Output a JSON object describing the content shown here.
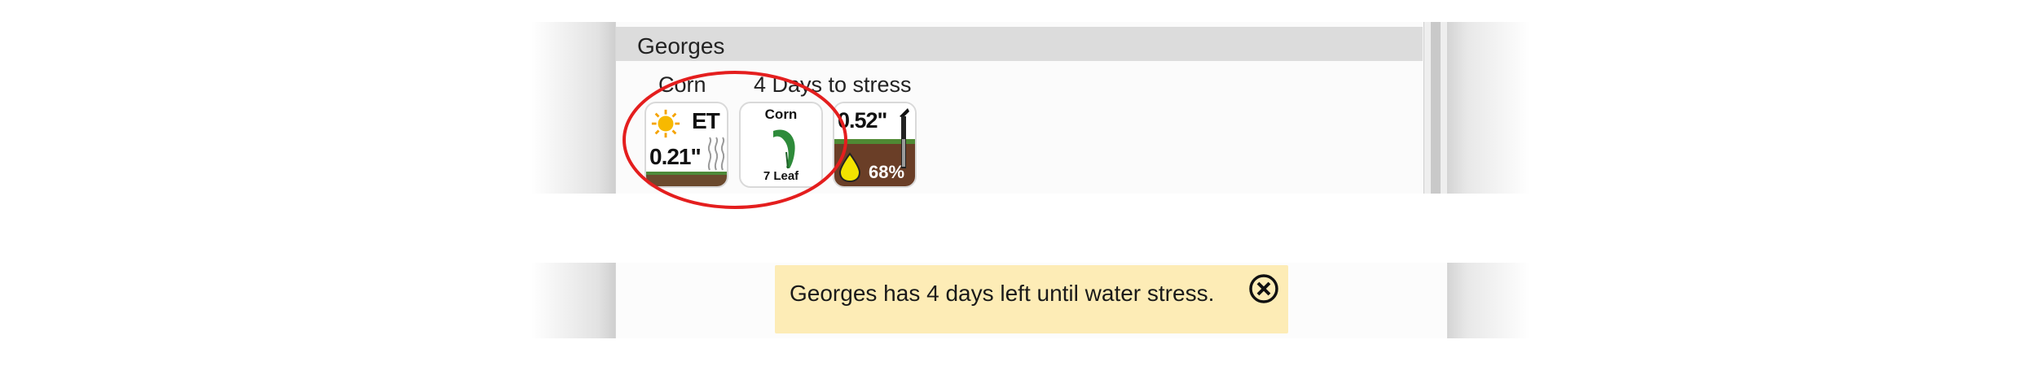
{
  "field": {
    "name": "Georges",
    "crop": "Corn",
    "stress_text": "4 Days to stress"
  },
  "tiles": {
    "et": {
      "label": "ET",
      "value": "0.21\"",
      "icon": "sun-icon"
    },
    "crop": {
      "name": "Corn",
      "stage": "7 Leaf",
      "icon": "leaf-icon"
    },
    "soil": {
      "value": "0.52\"",
      "moisture": "68%",
      "icons": [
        "probe-icon",
        "water-drop-icon"
      ]
    }
  },
  "alert": {
    "message": "Georges has 4 days left until water stress.",
    "close_icon": "close-icon"
  },
  "colors": {
    "alert_bg": "#fdecb6",
    "highlight": "#e41e1e",
    "leaf": "#2e8b3a",
    "soil": "#6a3e27",
    "drop": "#f2e300"
  }
}
